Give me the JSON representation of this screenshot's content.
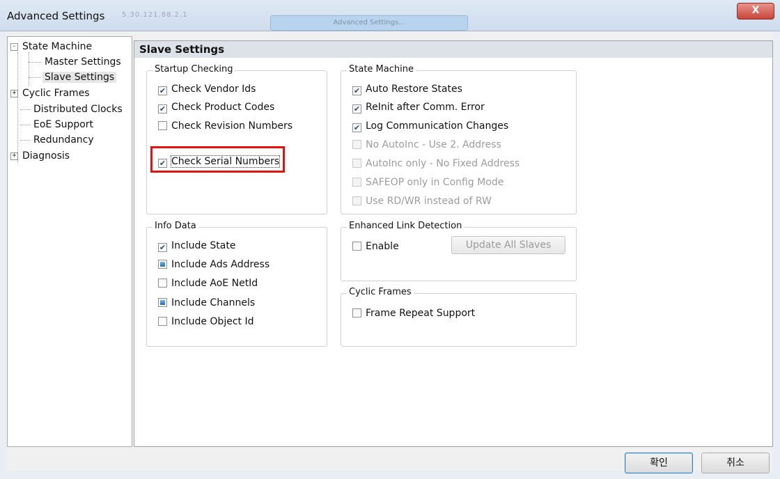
{
  "window": {
    "title": "Advanced Settings",
    "faint_title": "5.30.121.88.2.1",
    "faint_tab": "Advanced Settings...",
    "close_glyph": "X"
  },
  "tree": {
    "items": [
      {
        "label": "State Machine",
        "expander": "-"
      },
      {
        "label": "Master Settings"
      },
      {
        "label": "Slave Settings"
      },
      {
        "label": "Cyclic Frames",
        "expander": "+"
      },
      {
        "label": "Distributed Clocks"
      },
      {
        "label": "EoE Support"
      },
      {
        "label": "Redundancy"
      },
      {
        "label": "Diagnosis",
        "expander": "+"
      }
    ]
  },
  "content": {
    "header": "Slave Settings",
    "startup": {
      "title": "Startup Checking",
      "items": [
        "Check Vendor Ids",
        "Check Product Codes",
        "Check Revision Numbers",
        "Check Serial Numbers"
      ]
    },
    "state_machine": {
      "title": "State Machine",
      "items": [
        "Auto Restore States",
        "ReInit after Comm. Error",
        "Log Communication Changes",
        "No AutoInc - Use 2. Address",
        "AutoInc only - No Fixed Address",
        "SAFEOP only in Config Mode",
        "Use RD/WR instead of RW"
      ]
    },
    "info_data": {
      "title": "Info Data",
      "items": [
        "Include State",
        "Include Ads Address",
        "Include AoE NetId",
        "Include Channels",
        "Include Object Id"
      ]
    },
    "link_detection": {
      "title": "Enhanced Link Detection",
      "enable_label": "Enable",
      "update_button": "Update All Slaves"
    },
    "cyclic_frames": {
      "title": "Cyclic Frames",
      "items": [
        "Frame Repeat Support"
      ]
    }
  },
  "footer": {
    "ok": "확인",
    "cancel": "취소"
  },
  "colors": {
    "highlight": "#e01212",
    "close": "#c9463b"
  }
}
